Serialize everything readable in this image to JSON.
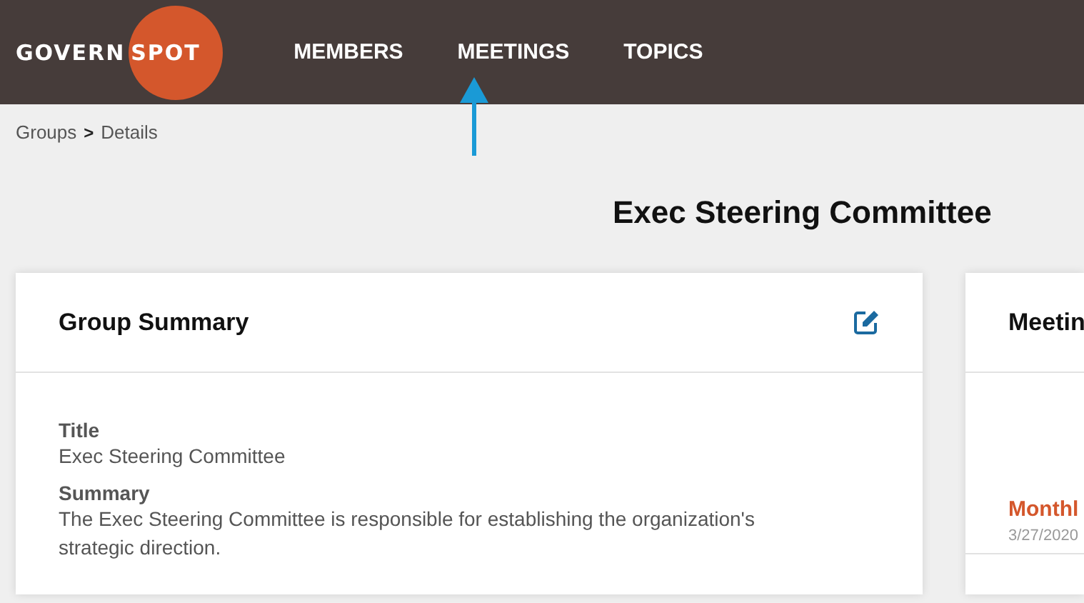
{
  "header": {
    "logo": {
      "left": "GOVERN",
      "right": "SPOT"
    },
    "nav": [
      {
        "label": "MEMBERS"
      },
      {
        "label": "MEETINGS"
      },
      {
        "label": "TOPICS"
      }
    ]
  },
  "breadcrumb": {
    "items": [
      "Groups",
      "Details"
    ],
    "separator": ">"
  },
  "page_title": "Exec Steering Committee",
  "group_summary": {
    "title": "Group Summary",
    "fields": [
      {
        "label": "Title",
        "value": "Exec Steering Committee"
      },
      {
        "label": "Summary",
        "value": "The Exec Steering Committee is responsible for establishing the organization's strategic direction."
      }
    ]
  },
  "meetings_card": {
    "title": "Meetin",
    "items": [
      {
        "name": "Monthl",
        "date": "3/27/2020"
      }
    ]
  }
}
